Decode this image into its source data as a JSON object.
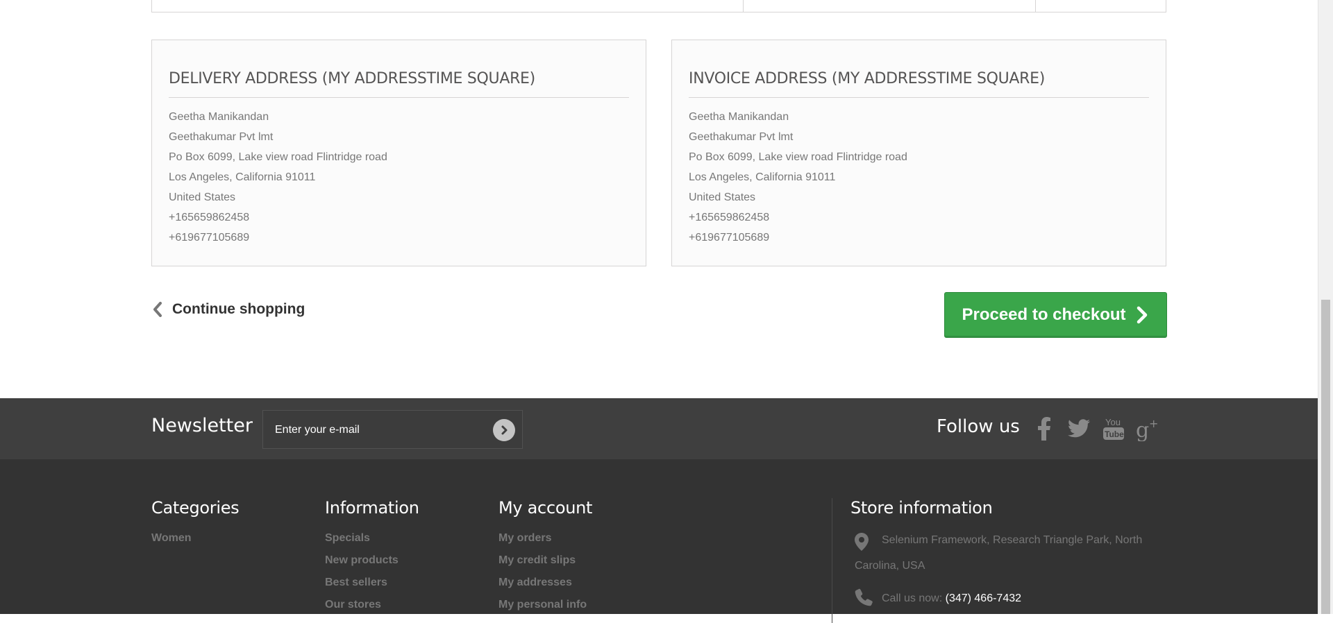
{
  "delivery": {
    "title": "DELIVERY ADDRESS (MY ADDRESSTIME SQUARE)",
    "lines": [
      "Geetha Manikandan",
      "Geethakumar Pvt lmt",
      "Po Box 6099, Lake view road Flintridge road",
      "Los Angeles, California 91011",
      "United States",
      "+165659862458",
      "+619677105689"
    ]
  },
  "invoice": {
    "title": "INVOICE ADDRESS (MY ADDRESSTIME SQUARE)",
    "lines": [
      "Geetha Manikandan",
      "Geethakumar Pvt lmt",
      "Po Box 6099, Lake view road Flintridge road",
      "Los Angeles, California 91011",
      "United States",
      "+165659862458",
      "+619677105689"
    ]
  },
  "nav": {
    "continue_label": "Continue shopping",
    "checkout_label": "Proceed to checkout"
  },
  "newsletter": {
    "title": "Newsletter",
    "placeholder": "Enter your e-mail",
    "follow_title": "Follow us",
    "social_icons": [
      "facebook-icon",
      "twitter-icon",
      "youtube-icon",
      "google-plus-icon"
    ]
  },
  "footer": {
    "categories": {
      "title": "Categories",
      "links": [
        "Women"
      ]
    },
    "information": {
      "title": "Information",
      "links": [
        "Specials",
        "New products",
        "Best sellers",
        "Our stores"
      ]
    },
    "account": {
      "title": "My account",
      "links": [
        "My orders",
        "My credit slips",
        "My addresses",
        "My personal info"
      ]
    },
    "store": {
      "title": "Store information",
      "address_line1": "Selenium Framework, Research Triangle Park, North",
      "address_line2": "Carolina, USA",
      "call_label": "Call us now:",
      "phone": "(347) 466-7432"
    }
  },
  "colors": {
    "checkout_green": "#3aa64a",
    "footer_dark": "#333333",
    "newsletter_band": "#3f3f3f"
  }
}
